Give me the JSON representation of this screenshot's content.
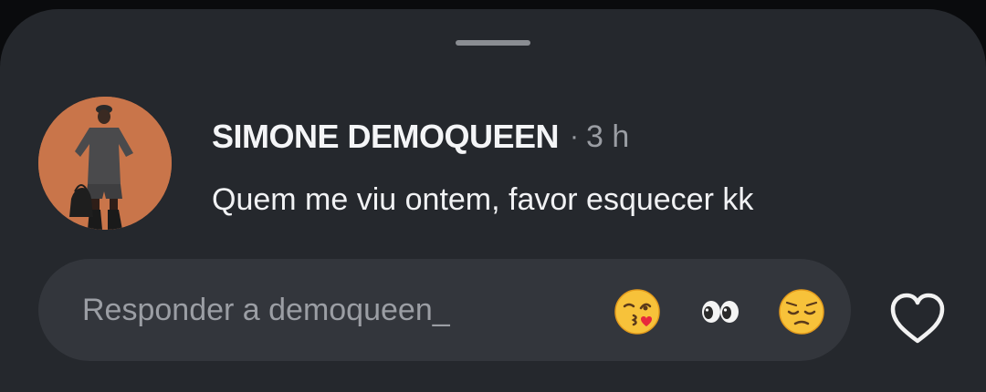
{
  "story_reply_sheet": {
    "author": {
      "name": "SIMONE DEMOQUEEN",
      "separator": "·",
      "time_ago": "3 h"
    },
    "message": "Quem me viu ontem, favor esquecer kk",
    "reply": {
      "placeholder": "Responder a demoqueen_",
      "value": ""
    },
    "quick_reactions": [
      {
        "icon": "face-blowing-kiss-emoji"
      },
      {
        "icon": "eyes-emoji"
      },
      {
        "icon": "pensive-face-emoji"
      }
    ],
    "like_icon": "heart-outline-icon"
  },
  "colors": {
    "sheet_background": "#25282d",
    "reply_bar_background": "#33363c",
    "primary_text": "#f4f5f7",
    "secondary_text": "#9a9da3",
    "avatar_background": "#c9754a"
  }
}
